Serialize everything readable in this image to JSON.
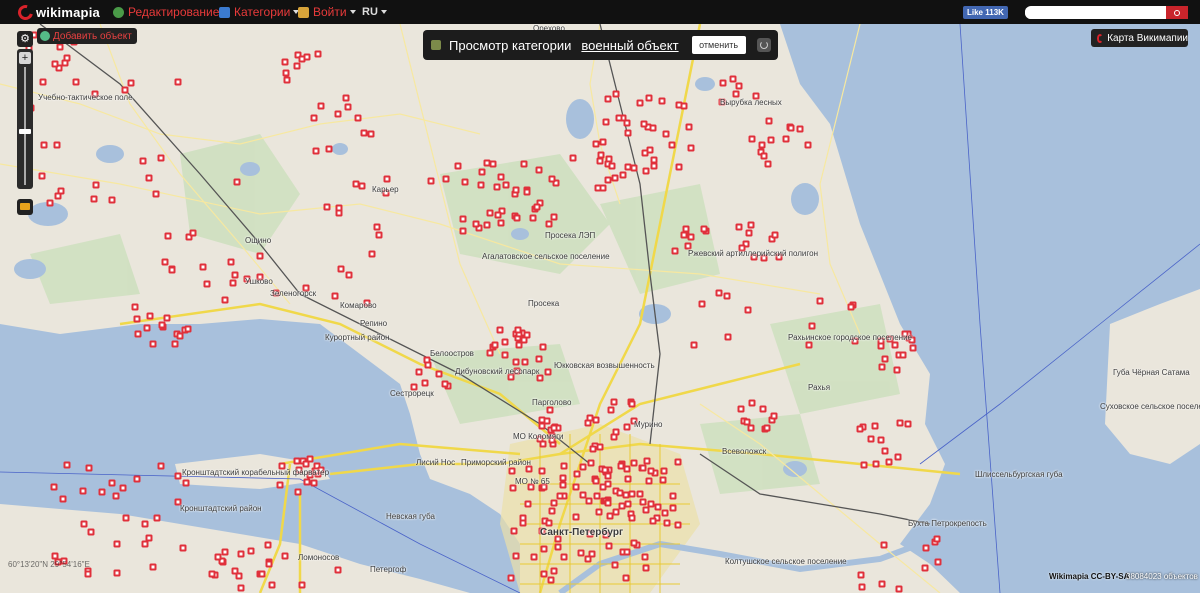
{
  "header": {
    "logo_text": "wikimapia",
    "menu_edit": "Редактирование",
    "menu_categories": "Категории",
    "menu_login": "Войти",
    "menu_lang": "RU",
    "facebook_like": "Like 113K",
    "search_placeholder": ""
  },
  "toolbar": {
    "add_object": "Добавить объект"
  },
  "category_bar": {
    "label": "Просмотр категории",
    "category_name": "военный объект",
    "cancel_label": "отменить"
  },
  "wikimapia_map_button": "Карта Викимапии",
  "footer": {
    "copyright": "Wikimapia CC-BY-SA",
    "objects_count": "38084023 объектов",
    "coordinates": "60°13'20\"N 29°54'16\"E"
  },
  "map_labels": [
    "Учебно-тактическое поле",
    "Орехово",
    "Вырубка лесных",
    "Карьер",
    "Ощино",
    "Ушково",
    "Зеленогорск",
    "Комарово",
    "Репино",
    "Курортный район",
    "Просека ЛЭП",
    "Агалатовское сельское поселение",
    "Ржевский артиллерийский полигон",
    "Просека",
    "Юкковская возвышенность",
    "Дибуновский лесопарк",
    "Сестрорецк",
    "Парголово",
    "МО Коломяги",
    "Мурино",
    "Рахьинское городское поселение",
    "Рахья",
    "Губа Чёрная Сатама",
    "Суховское сельское поселение",
    "Кронштадтский корабельный фарватер",
    "Приморский район",
    "МО № 65",
    "Всеволожск",
    "Шлиссельбургская губа",
    "Невская губа",
    "Бухта Петрокрепость",
    "Колтушское сельское поселение",
    "Санкт-Петербург",
    "Петергоф",
    "Ломоносов",
    "Кронштадтский район",
    "Лисий Нос",
    "Белоостров"
  ],
  "colors": {
    "accent_red": "#d9222a",
    "marker_red": "#e0303b",
    "water": "#a8c0dc",
    "land": "#eae6dc",
    "forest": "#cfe0c0",
    "city_road": "#f0d84a"
  },
  "icons": [
    "wikimapia-logo-icon",
    "edit-icon",
    "categories-icon",
    "login-icon",
    "settings-icon",
    "zoom-in-icon",
    "layers-icon",
    "military-category-icon",
    "refresh-icon",
    "search-icon"
  ]
}
